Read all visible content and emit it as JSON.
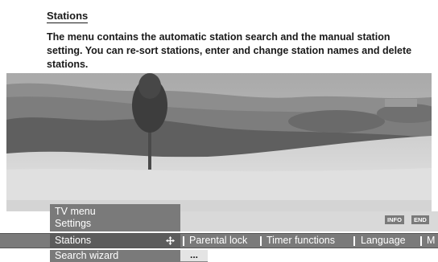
{
  "doc": {
    "title": "Stations",
    "description": "The menu contains the automatic station search and the manual station setting. You can re-sort stations, enter and change station names and delete stations."
  },
  "osd": {
    "breadcrumb_top": "TV menu",
    "breadcrumb_sub": "Settings",
    "keys": {
      "info": "INFO",
      "end": "END"
    },
    "menu": {
      "selected": "Stations",
      "items": [
        "Parental lock",
        "Timer functions",
        "Language",
        "M"
      ]
    },
    "submenu": {
      "label": "Search wizard",
      "value": "..."
    }
  },
  "icons": {
    "move": "four-way-arrow-icon"
  },
  "colors": {
    "osd_gray": "#7a7a7a",
    "osd_selected": "#5c5c5c",
    "band_light": "#d9d9d9"
  }
}
